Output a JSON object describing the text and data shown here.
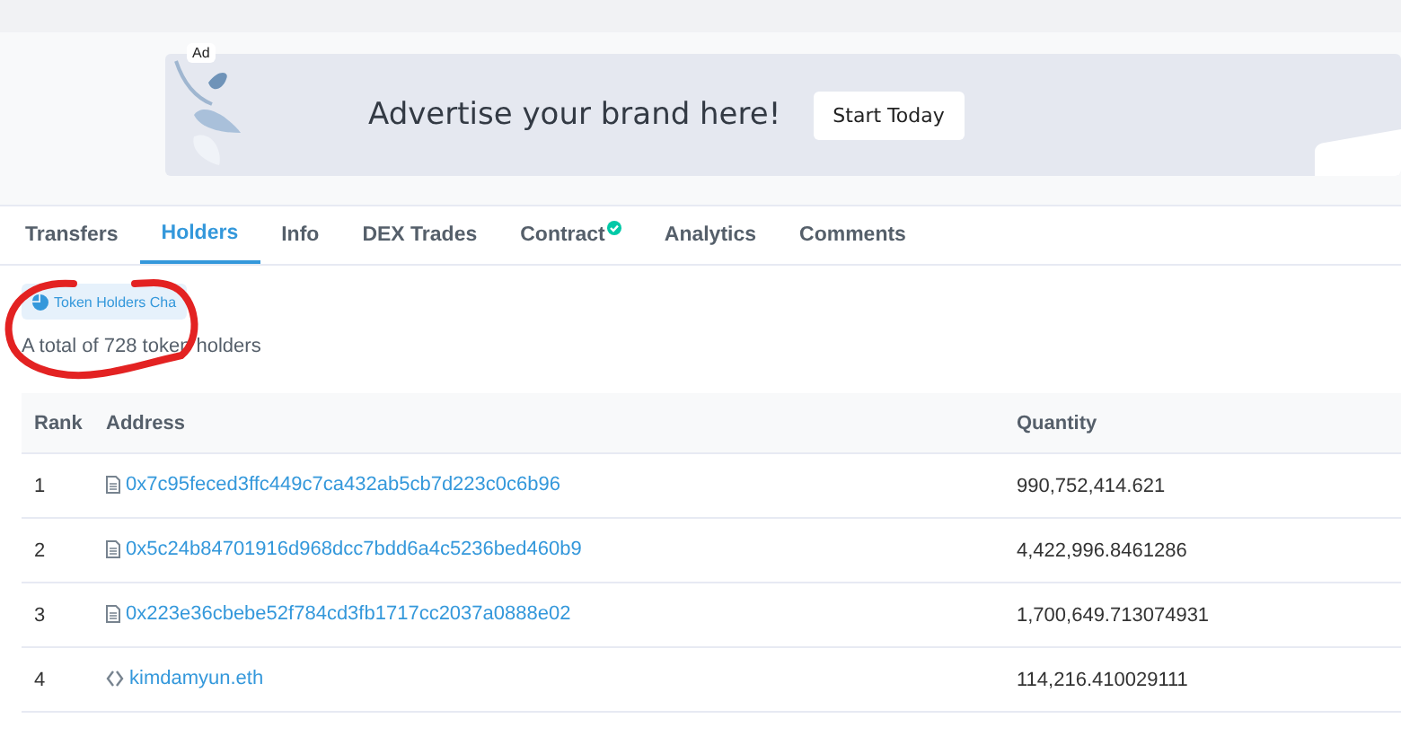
{
  "ad": {
    "badge": "Ad",
    "headline": "Advertise your brand here!",
    "button": "Start Today"
  },
  "tabs": [
    {
      "label": "Transfers",
      "selected": false,
      "verified": false
    },
    {
      "label": "Holders",
      "selected": true,
      "verified": false
    },
    {
      "label": "Info",
      "selected": false,
      "verified": false
    },
    {
      "label": "DEX Trades",
      "selected": false,
      "verified": false
    },
    {
      "label": "Contract",
      "selected": false,
      "verified": true
    },
    {
      "label": "Analytics",
      "selected": false,
      "verified": false
    },
    {
      "label": "Comments",
      "selected": false,
      "verified": false
    }
  ],
  "chart_button": "Token Holders Cha",
  "summary": "A total of 728 token holders",
  "table": {
    "columns": [
      "Rank",
      "Address",
      "Quantity"
    ],
    "rows": [
      {
        "rank": "1",
        "kind": "contract",
        "address": "0x7c95feced3ffc449c7ca432ab5cb7d223c0c6b96",
        "quantity": "990,752,414.621"
      },
      {
        "rank": "2",
        "kind": "contract",
        "address": "0x5c24b84701916d968dcc7bdd6a4c5236bed460b9",
        "quantity": "4,422,996.8461286"
      },
      {
        "rank": "3",
        "kind": "contract",
        "address": "0x223e36cbebe52f784cd3fb1717cc2037a0888e02",
        "quantity": "1,700,649.713074931"
      },
      {
        "rank": "4",
        "kind": "name",
        "address": "kimdamyun.eth",
        "quantity": "114,216.410029111"
      }
    ]
  }
}
